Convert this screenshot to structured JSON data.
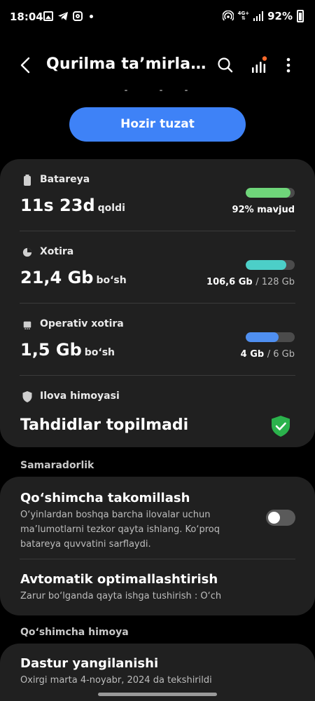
{
  "status_bar": {
    "time": "18:04",
    "network_top": "4G+",
    "battery": "92%"
  },
  "header": {
    "title": "Qurilma ta’mirlani…",
    "accent_dot_color": "#ff6a2b"
  },
  "fix_button": {
    "label": "Hozir tuzat",
    "color": "#3e82f7"
  },
  "battery": {
    "label": "Batareya",
    "value": "11s 23d",
    "unit": "qoldi",
    "stat": "92% mavjud",
    "level": 0.92,
    "bar_color": "#6fd67a"
  },
  "storage": {
    "label": "Xotira",
    "value": "21,4 Gb",
    "unit": "bo‘sh",
    "used": "106,6 Gb",
    "total": "/ 128 Gb",
    "level": 0.83,
    "bar_color": "#4ccfc8"
  },
  "ram": {
    "label": "Operativ xotira",
    "value": "1,5 Gb",
    "unit": "bo‘sh",
    "used": "4 Gb",
    "total": "/ 6 Gb",
    "level": 0.67,
    "bar_color": "#4f8ff0"
  },
  "app_protection": {
    "label": "Ilova himoyasi",
    "value": "Tahdidlar topilmadi",
    "shield_color": "#2bb24c"
  },
  "performance": {
    "heading": "Samaradorlik",
    "extra_title": "Qo‘shimcha takomillash",
    "extra_desc": [
      "O‘yinlardan boshqa barcha ilovalar uchun",
      "ma’lumotlarni tezkor qayta ishlang. Ko‘proq",
      "batareya quvvatini sarflaydi."
    ],
    "extra_toggle_on": false,
    "auto_title": "Avtomatik optimallashtirish",
    "auto_desc": "Zarur bo‘lganda qayta ishga tushirish : O‘ch"
  },
  "protection": {
    "heading": "Qo‘shimcha himoya",
    "update_title": "Dastur yangilanishi",
    "update_desc": "Oxirgi marta 4-noyabr, 2024 da tekshirildi"
  }
}
